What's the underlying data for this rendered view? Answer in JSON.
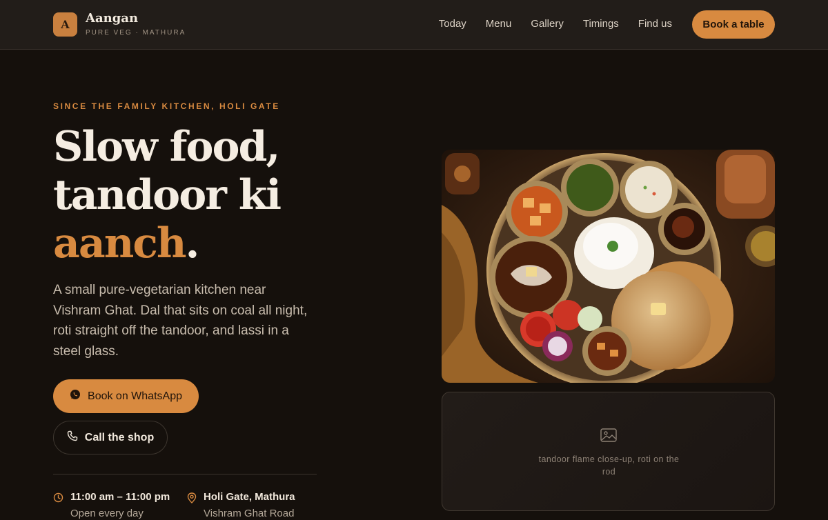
{
  "brand": {
    "logo_letter": "A",
    "name": "Aangan",
    "subtitle": "PURE VEG · MATHURA"
  },
  "nav": {
    "items": [
      "Today",
      "Menu",
      "Gallery",
      "Timings",
      "Find us"
    ],
    "cta": "Book a table"
  },
  "hero": {
    "eyebrow": "SINCE THE FAMILY KITCHEN, HOLI GATE",
    "headline_line1": "Slow food,",
    "headline_line2": "tandoor ki",
    "headline_accent": "aanch",
    "headline_end": ".",
    "lede": "A small pure-vegetarian kitchen near Vishram Ghat. Dal that sits on coal all night, roti straight off the tandoor, and lassi in a steel glass.",
    "primary_button": "Book on WhatsApp",
    "secondary_button": "Call the shop"
  },
  "info": {
    "hours_title": "11:00 am – 11:00 pm",
    "hours_sub": "Open every day",
    "location_title": "Holi Gate, Mathura",
    "location_sub": "Vishram Ghat Road"
  },
  "media": {
    "placeholder_caption": "tandoor flame close-up, roti on the rod"
  },
  "colors": {
    "accent": "#d88a40",
    "background": "#15100c",
    "topbar": "#221d19"
  },
  "icons": {
    "whatsapp": "whatsapp-icon",
    "phone": "phone-icon",
    "clock": "clock-icon",
    "pin": "map-pin-icon",
    "image": "image-icon"
  }
}
